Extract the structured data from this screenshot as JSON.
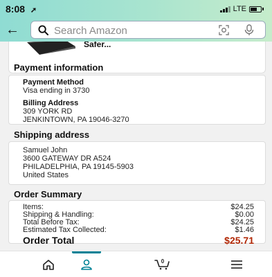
{
  "status_bar": {
    "time": "8:08",
    "time_arrow": "◂",
    "network": "LTE"
  },
  "search": {
    "placeholder": "Search Amazon"
  },
  "product": {
    "title": "Safer..."
  },
  "payment": {
    "section_title": "Payment information",
    "method_label": "Payment Method",
    "method_value": "Visa ending in 3730",
    "billing_label": "Billing Address",
    "billing_lines": [
      "309 YORK RD",
      "JENKINTOWN, PA 19046-3270"
    ]
  },
  "shipping": {
    "section_title": "Shipping address",
    "lines": [
      "Samuel John",
      "3600 GATEWAY DR A524",
      "PHILADELPHIA, PA 19145-5903",
      "United States"
    ]
  },
  "order_summary": {
    "section_title": "Order Summary",
    "rows": [
      {
        "label": "Items:",
        "value": "$24.25"
      },
      {
        "label": "Shipping & Handling:",
        "value": "$0.00"
      },
      {
        "label": "Total Before Tax:",
        "value": "$24.25"
      },
      {
        "label": "Estimated Tax Collected:",
        "value": "$1.46"
      }
    ],
    "total_label": "Order Total",
    "total_value": "$25.71"
  },
  "bottom_nav": {
    "items": [
      {
        "icon": "home-icon"
      },
      {
        "icon": "account-icon",
        "active": true
      },
      {
        "icon": "cart-icon",
        "badge": "0"
      },
      {
        "icon": "menu-icon"
      }
    ]
  },
  "colors": {
    "accent": "#008296",
    "price": "#b12704",
    "header_start": "#8fdcd3",
    "header_end": "#c6eccb"
  }
}
